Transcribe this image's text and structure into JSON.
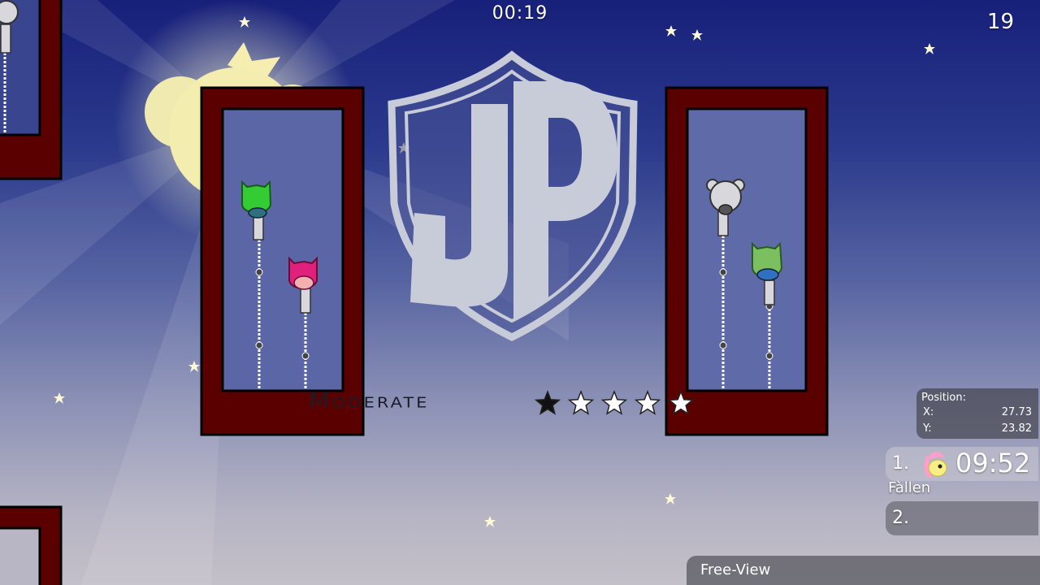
{
  "hud": {
    "timer": "00:19",
    "fps": "19",
    "difficulty": "Moderate",
    "stars": {
      "filled": 1,
      "total": 5
    },
    "position": {
      "label": "Position:",
      "x_label": "X:",
      "x_value": "27.73",
      "y_label": "Y:",
      "y_value": "23.82"
    },
    "scoreboard": [
      {
        "rank": "1.",
        "time": "09:52",
        "name": "Fàllen"
      },
      {
        "rank": "2."
      }
    ],
    "spectator_mode": "Free-View"
  },
  "colors": {
    "frame": "#5b0000",
    "logo": "#c8cbd8",
    "moon": "#f3eeb0"
  },
  "icons": {
    "player_avatar": "pony-icon"
  }
}
